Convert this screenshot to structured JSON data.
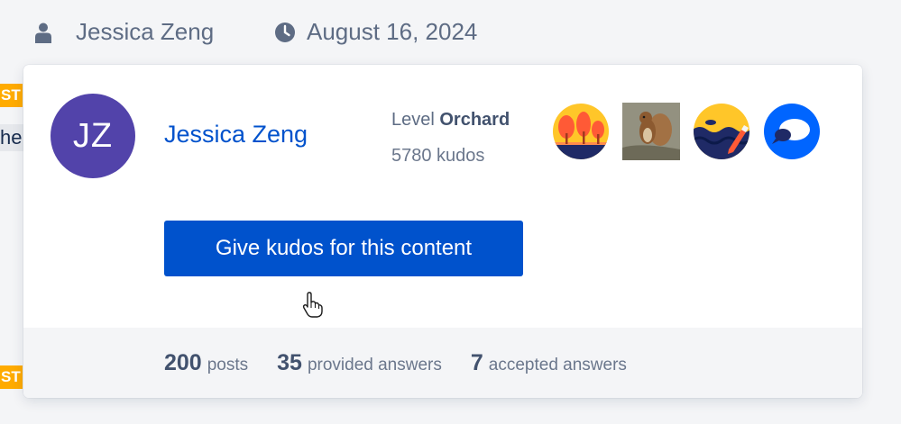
{
  "meta": {
    "author": "Jessica Zeng",
    "date": "August 16, 2024",
    "author_icon": "user-icon",
    "date_icon": "clock-icon"
  },
  "background": {
    "tag_top": "ST",
    "tag_bottom": "ST",
    "snippet": "he"
  },
  "card": {
    "avatar_initials": "JZ",
    "avatar_color": "#5243aa",
    "name": "Jessica Zeng",
    "level_prefix": "Level",
    "level_name": "Orchard",
    "kudos": "5780 kudos",
    "badges": [
      "orchard-trees-badge",
      "squirrel-photo-badge",
      "wave-pencil-badge",
      "chat-bubble-badge"
    ],
    "give_kudos_label": "Give kudos for this content",
    "accent_color": "#0052cc"
  },
  "stats": [
    {
      "value": "200",
      "label": "posts"
    },
    {
      "value": "35",
      "label": "provided answers"
    },
    {
      "value": "7",
      "label": "accepted answers"
    }
  ]
}
